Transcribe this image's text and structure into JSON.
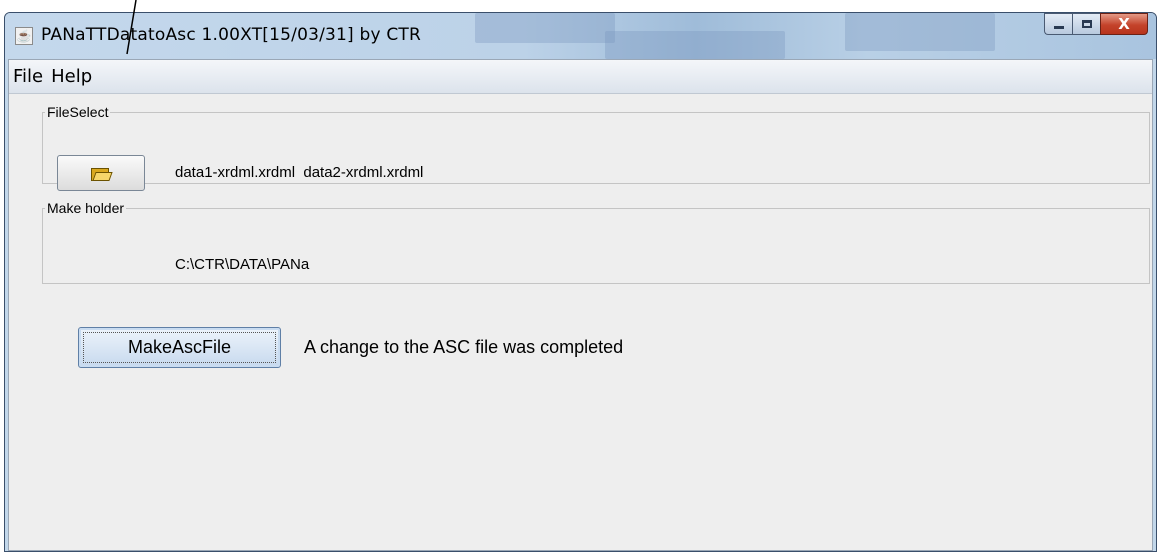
{
  "window": {
    "title": "PANaTTDatatoAsc 1.00XT[15/03/31] by CTR",
    "app_icon": "java-icon",
    "controls": {
      "minimize": "minimize-icon",
      "maximize": "maximize-icon",
      "close_label": "X"
    }
  },
  "menu": {
    "items": [
      "File",
      "Help"
    ]
  },
  "file_select": {
    "legend": "FileSelect",
    "button_icon": "open-folder-icon",
    "files": "data1-xrdml.xrdml  data2-xrdml.xrdml"
  },
  "make_holder": {
    "legend": "Make holder",
    "path": "C:\\CTR\\DATA\\PANa"
  },
  "action": {
    "button_label": "MakeAscFile",
    "status": "A change to the ASC file was completed"
  }
}
